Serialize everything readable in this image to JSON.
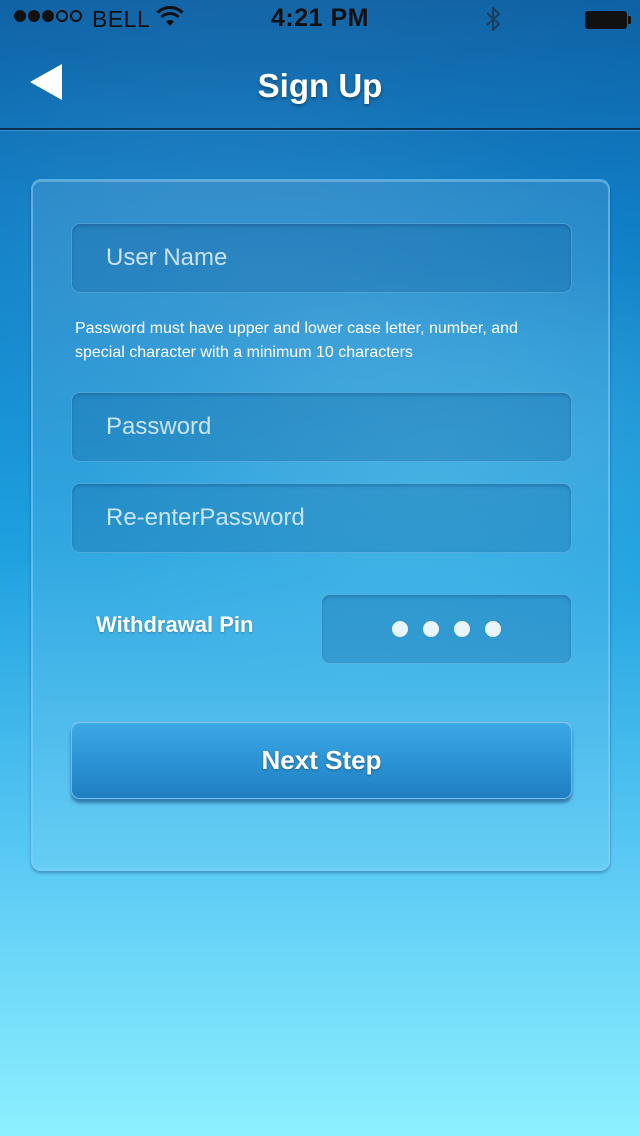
{
  "status_bar": {
    "carrier": "BELL",
    "time": "4:21 PM",
    "signal_bars_filled": 3,
    "signal_bars_total": 5,
    "icons": [
      "signal-dots-icon",
      "wifi-icon",
      "bluetooth-icon",
      "battery-icon"
    ]
  },
  "nav": {
    "title": "Sign Up",
    "back_icon": "back-arrow-icon"
  },
  "form": {
    "username": {
      "placeholder": "User Name",
      "value": ""
    },
    "password_hint": "Password must have upper and lower case letter, number, and special character with a minimum 10 characters",
    "password": {
      "placeholder": "Password",
      "value": ""
    },
    "reenter_password": {
      "placeholder": "Re-enterPassword",
      "value": ""
    },
    "withdrawal_pin": {
      "label": "Withdrawal Pin",
      "length": 4
    },
    "next_button_label": "Next Step"
  },
  "colors": {
    "header_blue": "#0a5fa3",
    "background_bottom": "#8ef0ff",
    "button_blue": "#2a92d3",
    "text_white": "#ffffff"
  }
}
